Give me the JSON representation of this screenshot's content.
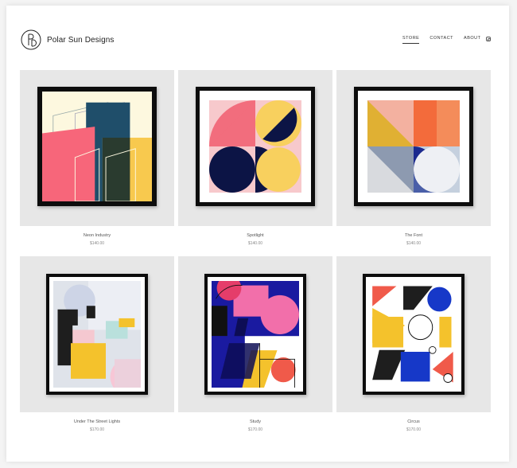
{
  "brand": {
    "name": "Polar Sun Designs",
    "logo_icon": "psd-monogram-icon"
  },
  "nav": {
    "items": [
      {
        "label": "STORE",
        "active": true
      },
      {
        "label": "CONTACT",
        "active": false
      },
      {
        "label": "ABOUT",
        "active": false
      }
    ],
    "social_icon": "instagram-icon"
  },
  "products": [
    {
      "name": "Neon Industry",
      "price": "$140.00"
    },
    {
      "name": "Spotlight",
      "price": "$140.00"
    },
    {
      "name": "The Font",
      "price": "$140.00"
    },
    {
      "name": "Under The Street Lights",
      "price": "$170.00"
    },
    {
      "name": "Study",
      "price": "$170.00"
    },
    {
      "name": "Circus",
      "price": "$170.00"
    }
  ]
}
